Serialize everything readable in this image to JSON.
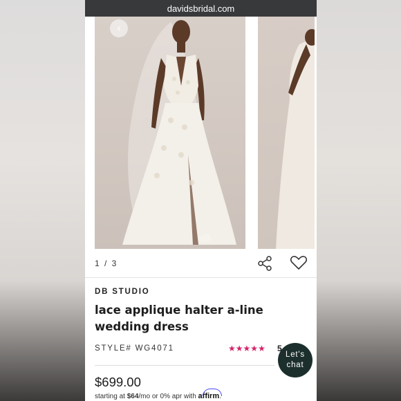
{
  "browser": {
    "url": "davidsbridal.com"
  },
  "gallery": {
    "counter": "1 / 3",
    "prev_icon": "chevron-left-icon",
    "share_icon": "share-icon",
    "wishlist_icon": "heart-icon"
  },
  "product": {
    "brand": "DB STUDIO",
    "title": "lace applique halter a-line wedding dress",
    "style": "STYLE# WG4071",
    "rating_stars": 5,
    "rating_value": "5",
    "price": "$699.00",
    "financing": {
      "prefix": "starting at ",
      "amount": "$64",
      "suffix": "/mo or 0% apr with ",
      "provider": "affirm",
      "end": "."
    }
  },
  "chat": {
    "line1": "Let's",
    "line2": "chat"
  },
  "colors": {
    "accent_pink": "#d4236a",
    "chat_bg": "#1c2f2c",
    "url_bar": "#38393b"
  }
}
